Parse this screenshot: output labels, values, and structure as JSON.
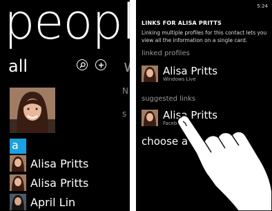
{
  "left_screen": {
    "title": "people",
    "pivot_current": "all",
    "pivot_next": "w",
    "peek_text_1": "N",
    "peek_text_2": "s",
    "group_letter": "a",
    "contacts": [
      {
        "name": "Alisa Pritts"
      },
      {
        "name": "Alisa Pritts"
      },
      {
        "name": "April Lin"
      }
    ],
    "icons": [
      "search-icon",
      "add-icon"
    ]
  },
  "right_screen": {
    "status_time": "5:24",
    "header": "LINKS FOR ALISA PRITTS",
    "description": "Linking multiple profiles for this contact lets you view all the information on a single card.",
    "linked_label": "linked profiles",
    "linked": {
      "name": "Alisa Pritts",
      "source": "Windows Live"
    },
    "suggested_label": "suggested links",
    "suggested": {
      "name": "Alisa Pritts",
      "source": "Facebook"
    },
    "choose_label": "choose a co"
  },
  "colors": {
    "accent": "#1ba1e2",
    "background": "#000000",
    "secondary_text": "#9a9a9a"
  }
}
